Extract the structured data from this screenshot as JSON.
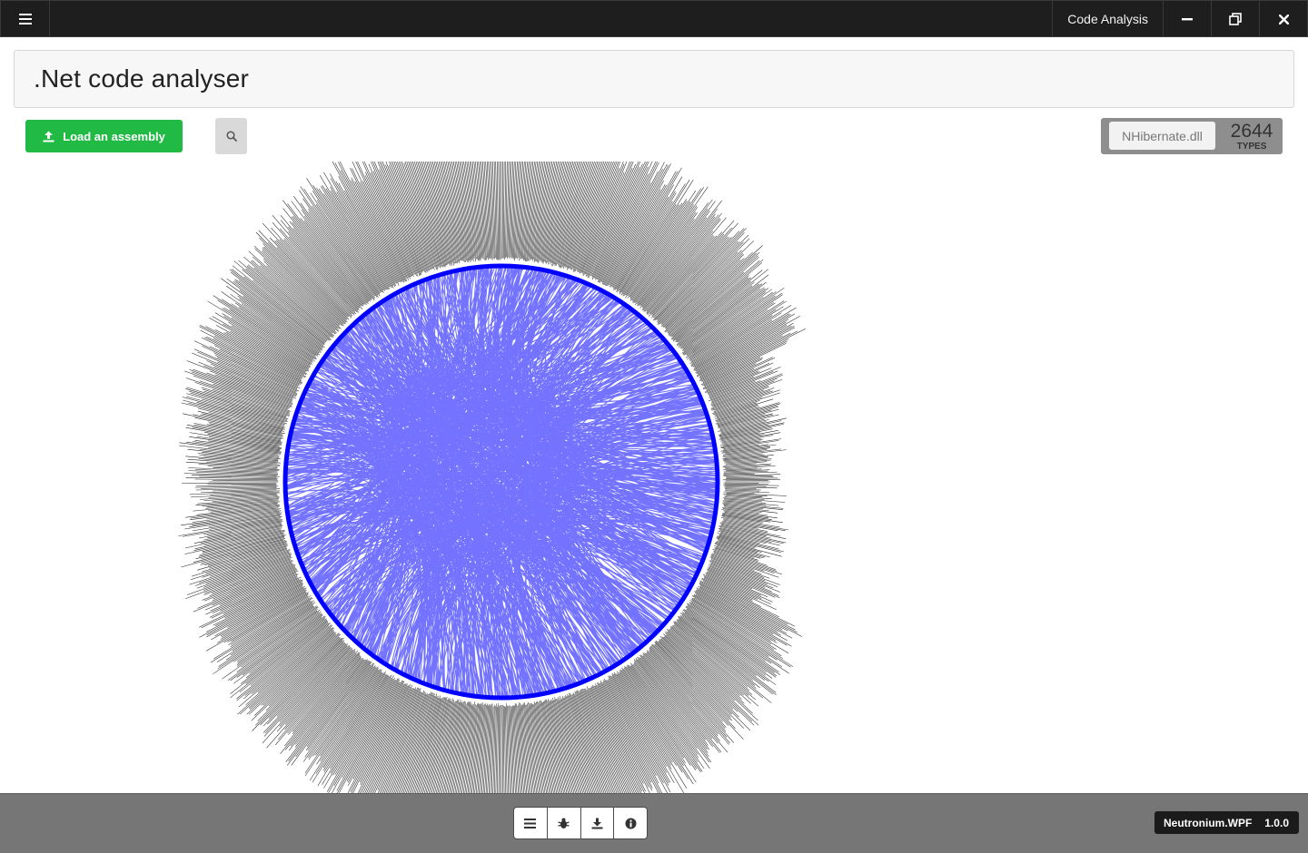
{
  "window": {
    "title": "Code Analysis",
    "icons": [
      "hamburger-menu-icon",
      "minimize-icon",
      "restore-icon",
      "close-icon"
    ]
  },
  "header": {
    "title": ".Net code analyser"
  },
  "toolbar": {
    "load_label": "Load an assembly",
    "load_color": "#21ba45",
    "search_icon": "search-icon"
  },
  "assembly": {
    "name": "NHibernate.dll",
    "count": "2644",
    "count_label": "TYPES"
  },
  "graph": {
    "type": "hierarchical edge bundling",
    "edge_color": "#0000ff",
    "label_color": "#000000"
  },
  "footer": {
    "buttons": [
      "list-icon",
      "bug-icon",
      "download-icon",
      "info-icon"
    ],
    "app_name": "Neutronium.WPF",
    "version": "1.0.0"
  }
}
